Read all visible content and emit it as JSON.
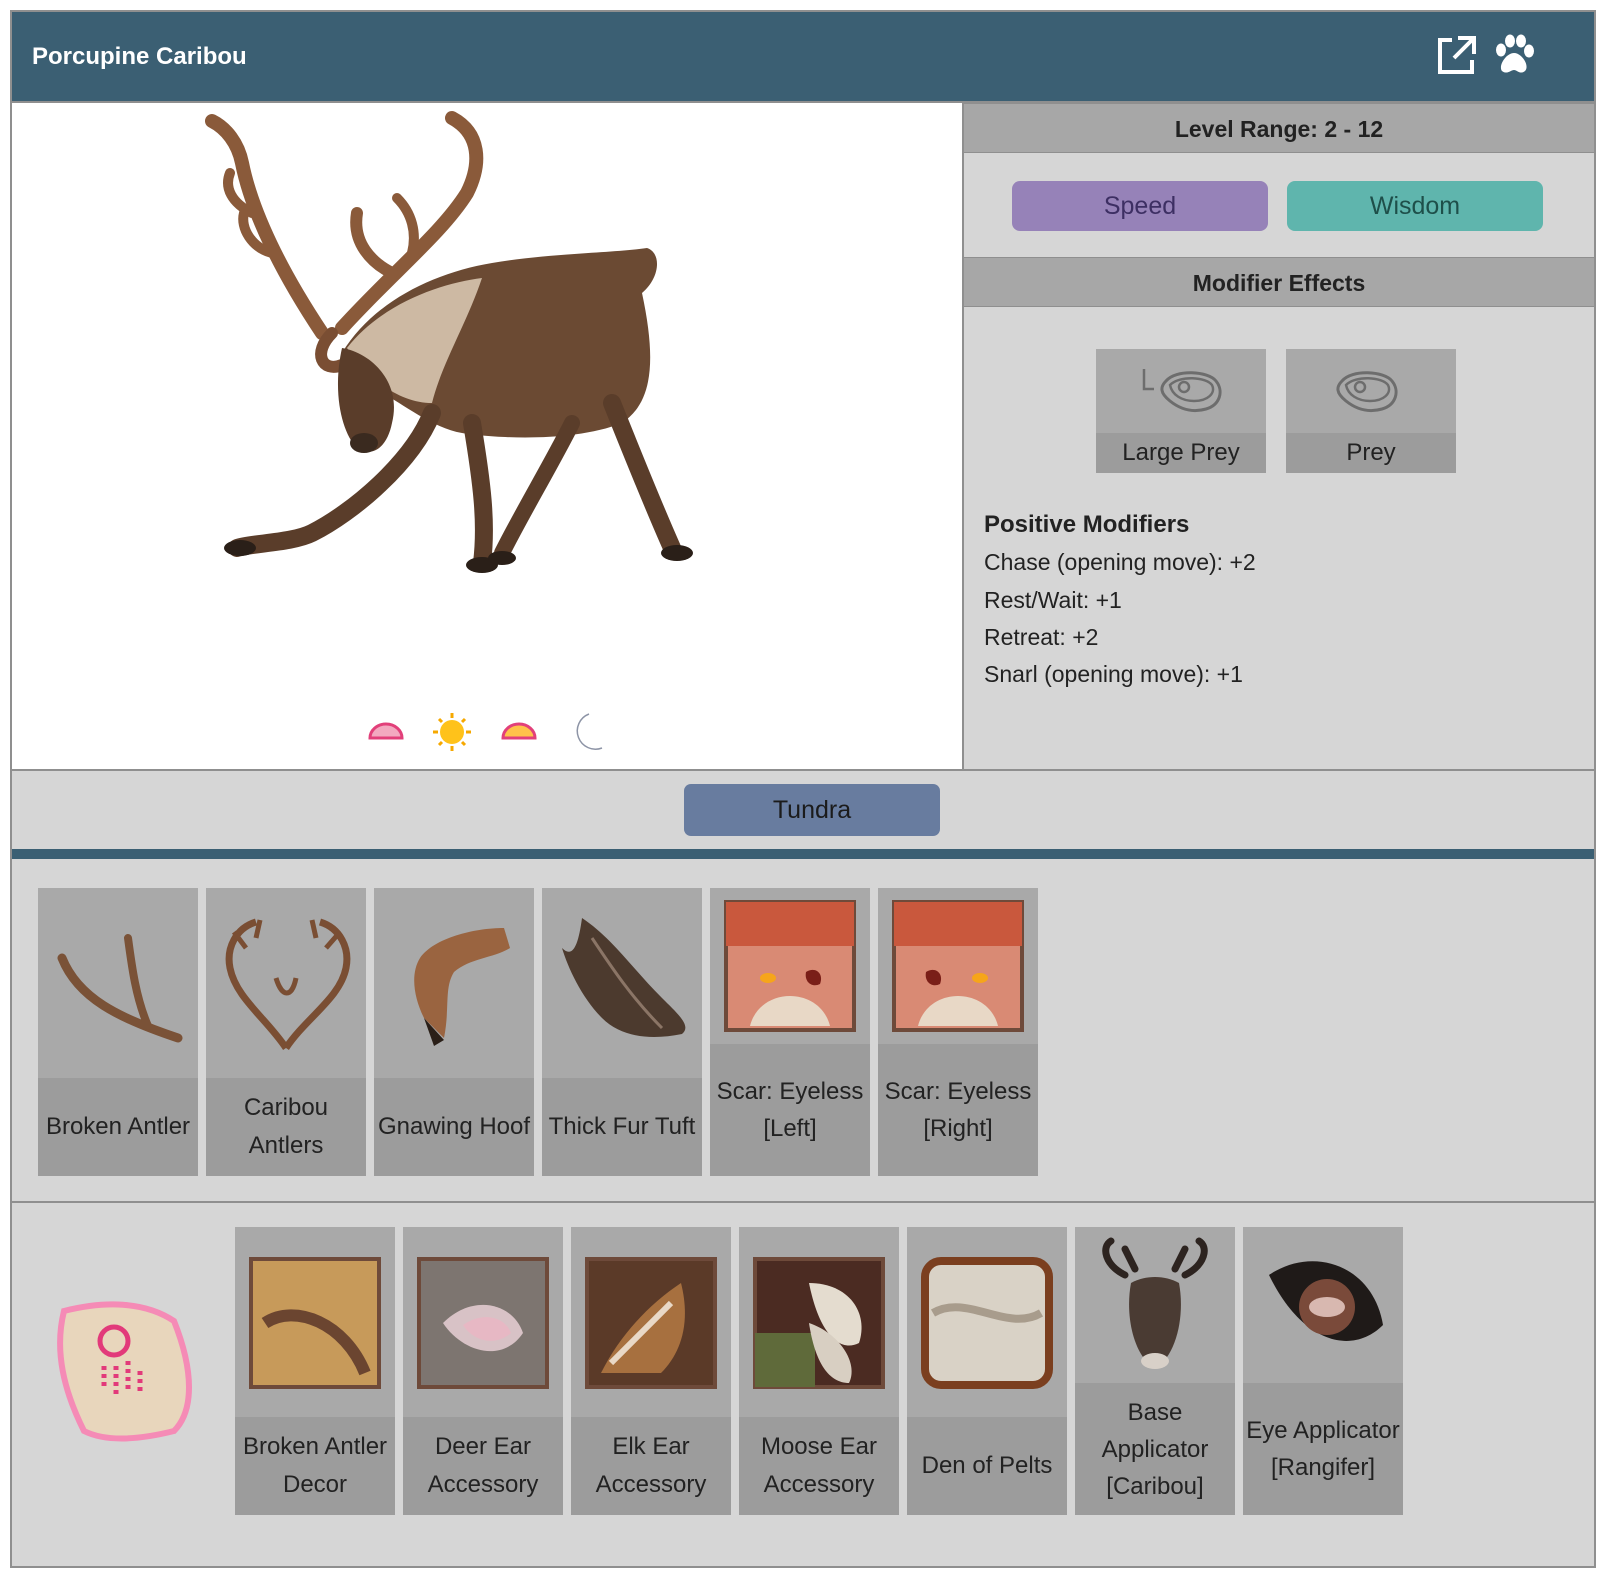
{
  "window": {
    "title": "Porcupine Caribou",
    "icons": [
      "external-link-icon",
      "paw-icon"
    ]
  },
  "creature": {
    "image": "caribou-illustration",
    "times_of_day": [
      "dawn-icon",
      "day-icon",
      "dusk-icon",
      "night-icon"
    ]
  },
  "info": {
    "level_range": "Level Range: 2 - 12",
    "stats": [
      {
        "label": "Speed",
        "color": "#9682b8"
      },
      {
        "label": "Wisdom",
        "color": "#5fb5ad"
      }
    ],
    "modifier_effects_title": "Modifier Effects",
    "tags": [
      {
        "label": "Large Prey",
        "icon": "large-prey-icon"
      },
      {
        "label": "Prey",
        "icon": "prey-icon"
      }
    ],
    "positive_modifiers_title": "Positive Modifiers",
    "positive_modifiers": [
      "Chase (opening move): +2",
      "Rest/Wait: +1",
      "Retreat: +2",
      "Snarl (opening move): +1"
    ]
  },
  "biome": {
    "label": "Tundra",
    "color": "#687c9f"
  },
  "drops": [
    {
      "label": "Broken Antler",
      "icon": "broken-antler-icon"
    },
    {
      "label": "Caribou Antlers",
      "icon": "caribou-antlers-icon"
    },
    {
      "label": "Gnawing Hoof",
      "icon": "hoof-icon"
    },
    {
      "label": "Thick Fur Tuft",
      "icon": "fur-tuft-icon"
    },
    {
      "label": "Scar: Eyeless [Left]",
      "icon": "scar-left-icon"
    },
    {
      "label": "Scar: Eyeless [Right]",
      "icon": "scar-right-icon"
    }
  ],
  "rewards": {
    "scroll_icon": "scroll-icon",
    "items": [
      {
        "label": "Broken Antler Decor",
        "icon": "antler-decor-icon"
      },
      {
        "label": "Deer Ear Accessory",
        "icon": "deer-ear-icon"
      },
      {
        "label": "Elk Ear Accessory",
        "icon": "elk-ear-icon"
      },
      {
        "label": "Moose Ear Accessory",
        "icon": "moose-ear-icon"
      },
      {
        "label": "Den of Pelts",
        "icon": "pelts-icon"
      },
      {
        "label": "Base Applicator [Caribou]",
        "icon": "caribou-head-icon"
      },
      {
        "label": "Eye Applicator [Rangifer]",
        "icon": "eye-icon"
      }
    ]
  }
}
